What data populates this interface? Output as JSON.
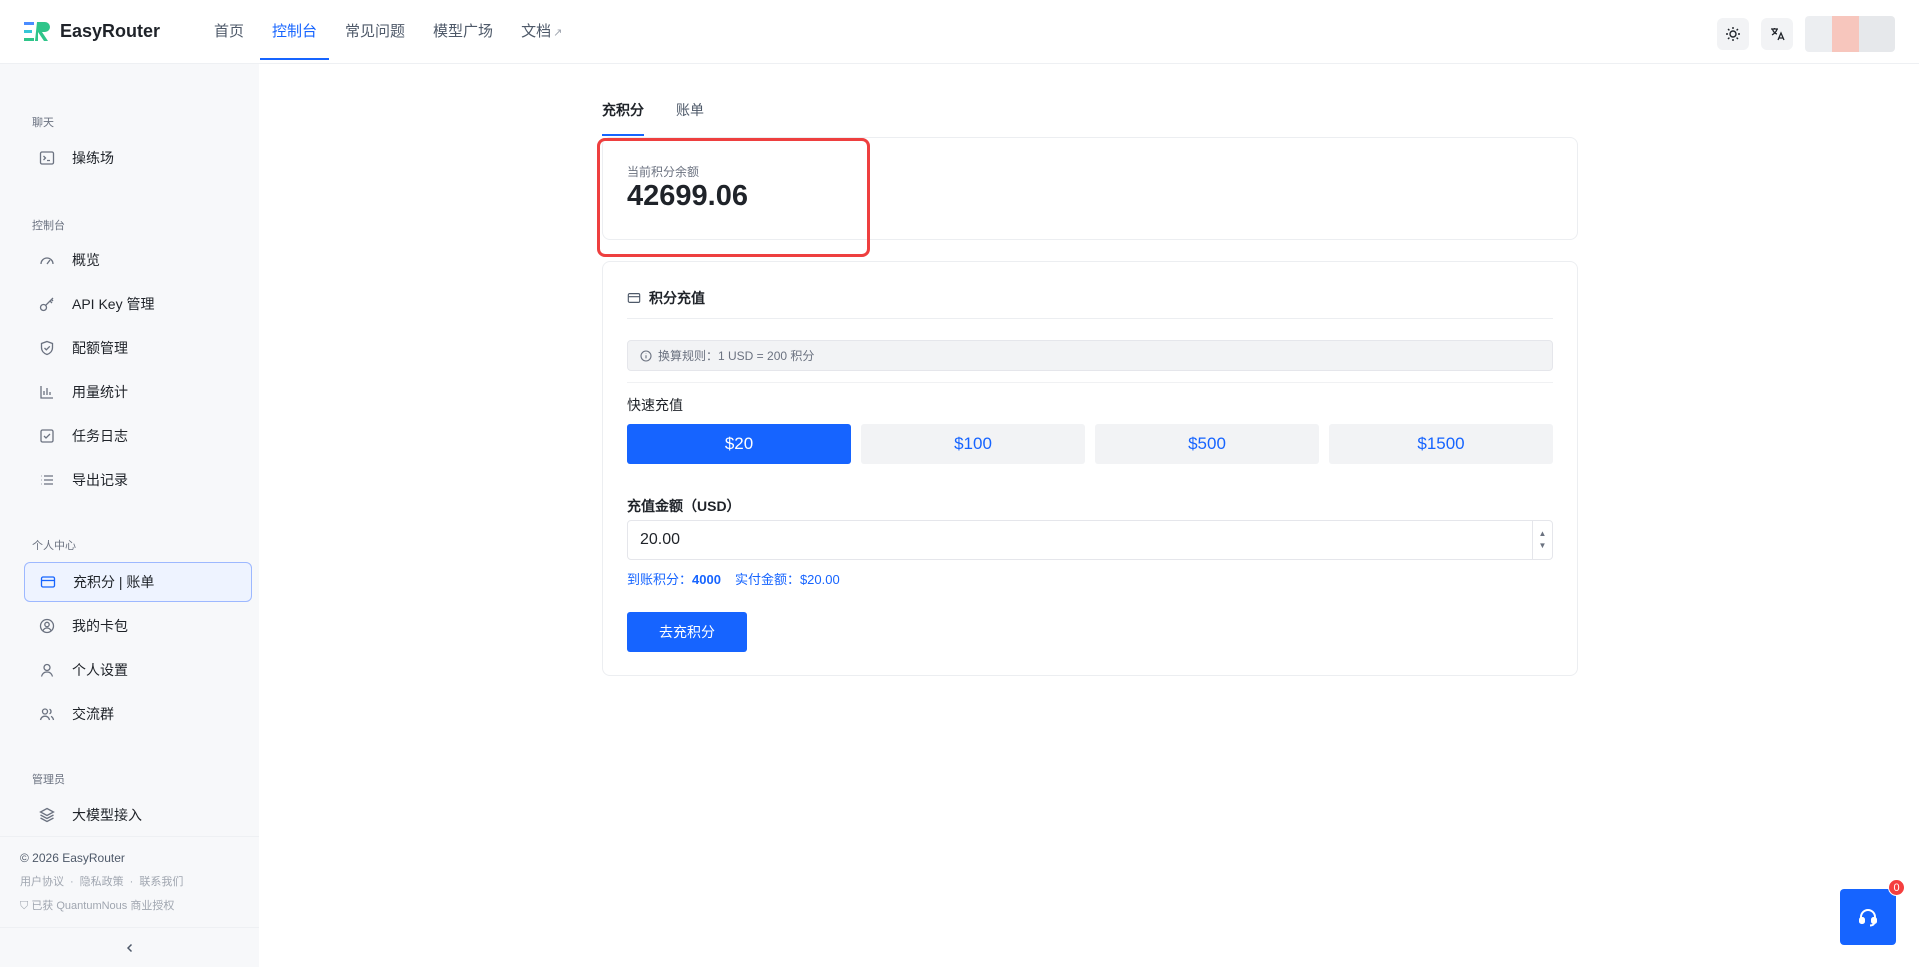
{
  "header": {
    "brand": "EasyRouter",
    "nav": [
      {
        "label": "首页"
      },
      {
        "label": "控制台"
      },
      {
        "label": "常见问题"
      },
      {
        "label": "模型广场"
      },
      {
        "label": "文档"
      }
    ],
    "active_nav": "控制台"
  },
  "sidebar": {
    "groups": {
      "chat": "聊天",
      "console": "控制台",
      "personal": "个人中心",
      "admin": "管理员"
    },
    "items": {
      "playground": "操练场",
      "overview": "概览",
      "api_key": "API Key 管理",
      "quota": "配额管理",
      "usage": "用量统计",
      "task_log": "任务日志",
      "export": "导出记录",
      "recharge": "充积分 | 账单",
      "wallet": "我的卡包",
      "settings": "个人设置",
      "community": "交流群",
      "models": "大模型接入"
    },
    "active_item": "充积分 | 账单",
    "footer": {
      "copyright": "© 2026 EasyRouter",
      "links": [
        "用户协议",
        "隐私政策",
        "联系我们"
      ],
      "license": "已获 QuantumNous 商业授权"
    }
  },
  "tabs": [
    "充积分",
    "账单"
  ],
  "active_tab": "充积分",
  "balance": {
    "label": "当前积分余额",
    "value": "42699.06"
  },
  "recharge": {
    "title": "积分充值",
    "rule": "换算规则：1 USD = 200 积分",
    "quick_label": "快速充值",
    "quick_options": [
      "$20",
      "$100",
      "$500",
      "$1500"
    ],
    "selected_option": "$20",
    "amount_label": "充值金额（USD）",
    "amount_value": "20.00",
    "credited_label": "到账积分：",
    "credited_value": "4000",
    "paid_label": "实付金额：",
    "paid_value": "$20.00",
    "submit_label": "去充积分"
  },
  "support_badge": "0",
  "colors": {
    "primary": "#1664ff",
    "highlight_border": "#ee3f3f",
    "badge": "#f53f3f"
  }
}
